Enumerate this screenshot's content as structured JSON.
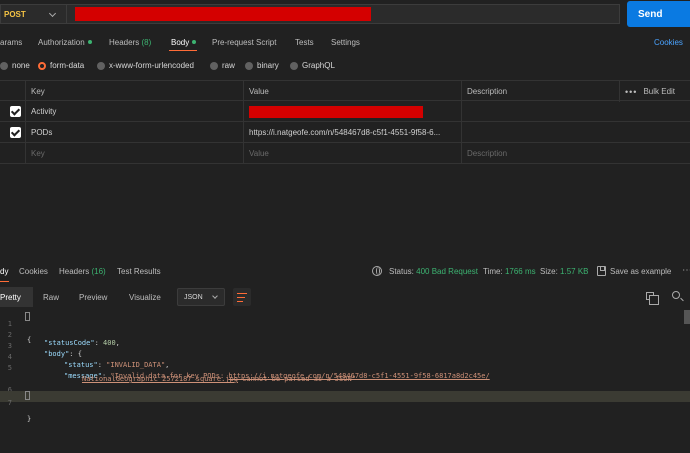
{
  "request": {
    "method": "POST",
    "send_label": "Send"
  },
  "request_tabs": {
    "params": "arams",
    "authorization": "Authorization",
    "headers": "Headers",
    "headers_count": "(8)",
    "body": "Body",
    "pre_request": "Pre-request Script",
    "tests": "Tests",
    "settings": "Settings",
    "cookies": "Cookies"
  },
  "body_types": [
    "none",
    "form-data",
    "x-www-form-urlencoded",
    "raw",
    "binary",
    "GraphQL"
  ],
  "body_type_selected": "form-data",
  "params_table": {
    "columns": {
      "key": "Key",
      "value": "Value",
      "description": "Description",
      "bulk_edit": "Bulk Edit"
    },
    "rows": [
      {
        "key": "Activity",
        "value": ""
      },
      {
        "key": "PODs",
        "value": "https://i.natgeofe.com/n/548467d8-c5f1-4551-9f58-6..."
      }
    ],
    "placeholder": {
      "key": "Key",
      "value": "Value",
      "description": "Description"
    }
  },
  "response_tabs": {
    "body": "dy",
    "cookies": "Cookies",
    "headers": "Headers",
    "headers_count": "(16)",
    "test_results": "Test Results"
  },
  "response_status": {
    "status_label": "Status:",
    "status_value": "400 Bad Request",
    "time_label": "Time:",
    "time_value": "1766 ms",
    "size_label": "Size:",
    "size_value": "1.57 KB",
    "save_example": "Save as example"
  },
  "response_view": {
    "pretty": "Pretty",
    "raw": "Raw",
    "preview": "Preview",
    "visualize": "Visualize",
    "format": "JSON"
  },
  "response_body": {
    "line_numbers": [
      "1",
      "2",
      "3",
      "4",
      "5",
      "6",
      "7"
    ],
    "status_code_key": "\"statusCode\"",
    "status_code_value": "400",
    "body_key": "\"body\"",
    "status_key": "\"status\"",
    "status_value": "\"INVALID_DATA\"",
    "message_key": "\"message\"",
    "message_prefix": "\"Invalid data for key PODs: ",
    "message_url_1": "https://i.natgeofe.com/n/548467d8-c5f1-4551-9f58-6817a8d2c45e/",
    "message_url_2": "NationalGeographic_2572187_square.jpg",
    "message_suffix": " cannot be parsed as a JSON\""
  },
  "colors": {
    "accent": "#ff6c37",
    "send": "#0a7ae2",
    "method": "#f5c344",
    "success": "#3cb371",
    "redaction": "#d40000"
  }
}
